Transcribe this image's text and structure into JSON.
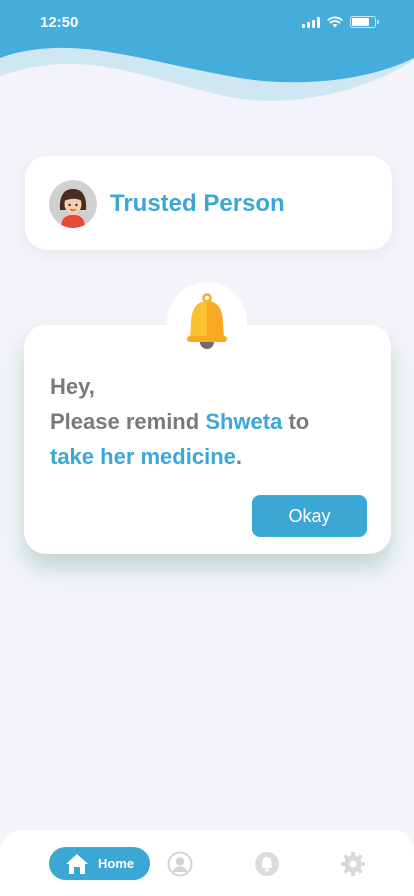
{
  "status_bar": {
    "time": "12:50"
  },
  "trusted_card": {
    "title": "Trusted Person"
  },
  "reminder": {
    "line1": "Hey,",
    "prefix": "Please remind ",
    "name": "Shweta",
    "middle": " to",
    "task": "take her medicine",
    "suffix": ".",
    "okay_label": "Okay"
  },
  "bottom_nav": {
    "home_label": "Home",
    "items": [
      "home-icon",
      "profile-icon",
      "bell-icon",
      "gear-icon"
    ]
  },
  "colors": {
    "accent": "#3ba7d5",
    "text_gray": "#7a7a7a",
    "bell": "#fbc02d",
    "background": "#f3f4f9"
  }
}
